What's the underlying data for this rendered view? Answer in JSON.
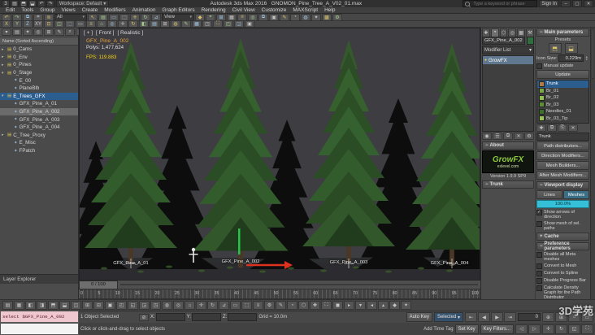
{
  "titlebar": {
    "qat": [
      {
        "n": "app-logo-icon",
        "g": "3"
      },
      {
        "n": "new-file-icon",
        "g": "▤"
      },
      {
        "n": "open-file-icon",
        "g": "⬒"
      },
      {
        "n": "save-file-icon",
        "g": "⬓"
      },
      {
        "n": "undo-icon",
        "g": "↶"
      },
      {
        "n": "redo-icon",
        "g": "↷"
      }
    ],
    "workspace": "Workspace: Default",
    "app_title": "Autodesk 3ds Max 2016",
    "doc_title": "GNOMON_Pine_Tree_A_V02_01.max",
    "search_placeholder": "Type a keyword or phrase",
    "sign_in": "Sign In",
    "minimize": "–",
    "maximize": "▢",
    "close": "✕"
  },
  "menubar": {
    "items": [
      "Edit",
      "Tools",
      "Group",
      "Views",
      "Create",
      "Modifiers",
      "Animation",
      "Graph Editors",
      "Rendering",
      "Civil View",
      "Customize",
      "MAXScript",
      "Help"
    ]
  },
  "toolbar_main": {
    "icons_a": [
      "↶",
      "↷",
      "⧉",
      "⌗",
      "≋"
    ],
    "filter_value": "All",
    "icons_b": [
      "↖",
      "▤",
      "▭",
      "⬚",
      "✛",
      "↻",
      "⊿"
    ],
    "coord_value": "View",
    "icons_c": [
      "◆",
      "⌖",
      "⊞",
      "▦",
      "≡",
      "◎",
      "⧉",
      "▣",
      "✎",
      "◔",
      "◍",
      "✦",
      "▩",
      "⚙"
    ]
  },
  "toolbar_axis": {
    "icons_a": [
      "X",
      "Y",
      "Z",
      "XY"
    ],
    "icons_b": [
      "⊡",
      "◫",
      "⬚",
      "▭",
      "≡",
      "⌂",
      "◎",
      "✛",
      "↻",
      "◧",
      "▤",
      "⊞",
      "◍",
      "✎",
      "▦",
      "◳",
      "⛶",
      "◰",
      "◲",
      "▣"
    ]
  },
  "explorer": {
    "tool_icons": [
      "▾",
      "▤",
      "✦",
      "◎",
      "⊞",
      "✎",
      "⌕",
      "≡"
    ],
    "header": "Name (Sorted Ascending)",
    "rows": [
      {
        "label": "0_Cams",
        "exp": "▸",
        "icon": "▤",
        "iconstyle": "color:#d9c05a",
        "style": ""
      },
      {
        "label": "0_Env",
        "exp": "▸",
        "icon": "▤",
        "iconstyle": "color:#d9c05a",
        "style": ""
      },
      {
        "label": "0_Pines",
        "exp": "▸",
        "icon": "▤",
        "iconstyle": "color:#d9c05a",
        "style": ""
      },
      {
        "label": "0_Stage",
        "exp": "▾",
        "icon": "▤",
        "iconstyle": "color:#d9c05a",
        "style": ""
      },
      {
        "label": "E_00",
        "exp": "",
        "icon": "✦",
        "iconstyle": "color:#9fb6d8",
        "style": "padding-left:10px"
      },
      {
        "label": "PlaneBlb",
        "exp": "",
        "icon": "✦",
        "iconstyle": "color:#9fb6d8",
        "style": "padding-left:10px"
      },
      {
        "label": "E_Trees_GFX",
        "exp": "▾",
        "icon": "▤",
        "iconstyle": "color:#d9c05a",
        "style": "",
        "selected": true
      },
      {
        "label": "GFX_Pine_A_01",
        "exp": "",
        "icon": "✦",
        "iconstyle": "color:#9fb6d8",
        "style": "padding-left:10px"
      },
      {
        "label": "GFX_Pine_A_002",
        "exp": "",
        "icon": "✦",
        "iconstyle": "color:#9fb6d8",
        "style": "padding-left:10px",
        "current": true
      },
      {
        "label": "GFX_Pine_A_003",
        "exp": "",
        "icon": "✦",
        "iconstyle": "color:#9fb6d8",
        "style": "padding-left:10px"
      },
      {
        "label": "GFX_Pine_A_004",
        "exp": "",
        "icon": "✦",
        "iconstyle": "color:#9fb6d8",
        "style": "padding-left:10px"
      },
      {
        "label": "C_Tree_Proxy",
        "exp": "▸",
        "icon": "▤",
        "iconstyle": "color:#d9c05a",
        "style": ""
      },
      {
        "label": "E_Misc",
        "exp": "",
        "icon": "✦",
        "iconstyle": "color:#9fb6d8",
        "style": "padding-left:10px"
      },
      {
        "label": "FPatch",
        "exp": "",
        "icon": "✦",
        "iconstyle": "color:#9fb6d8",
        "style": "padding-left:10px"
      }
    ],
    "footer": "Layer Explorer"
  },
  "viewport": {
    "label_plus": "[ + ]",
    "label_view": "[ Front ]",
    "label_shading": "[ Realistic ]",
    "stats_name": "GFX_Pine_A_002",
    "stats_polys": "Polys: 1,477,624",
    "stats_fps": "FPS: 119.883",
    "tree_labels": [
      {
        "t": "GFX_Pine_A_01",
        "style": "left:63px;top:286px"
      },
      {
        "t": "GFX_Pine_A_002",
        "style": "left:198px;top:284px"
      },
      {
        "t": "GFX_Pine_A_003",
        "style": "left:331px;top:285px"
      },
      {
        "t": "GFX_Pine_A_004",
        "style": "left:455px;top:286px"
      }
    ]
  },
  "timeline": {
    "slider": "0 / 100",
    "ticks": [
      "0",
      "5",
      "10",
      "15",
      "20",
      "25",
      "30",
      "35",
      "40",
      "45",
      "50",
      "55",
      "60",
      "65",
      "70",
      "75",
      "80",
      "85",
      "90",
      "95",
      "100"
    ]
  },
  "cmdpanel": {
    "tabs": [
      {
        "n": "create-tab-icon",
        "g": "✚"
      },
      {
        "n": "modify-tab-icon",
        "g": "◔",
        "active": true
      },
      {
        "n": "hierarchy-tab-icon",
        "g": "⬡"
      },
      {
        "n": "motion-tab-icon",
        "g": "◎"
      },
      {
        "n": "display-tab-icon",
        "g": "▦"
      },
      {
        "n": "utilities-tab-icon",
        "g": "⚒"
      }
    ],
    "object_name": "GFX_Pine_A_002",
    "modifier_list": "Modifier List",
    "stack": [
      {
        "label": "GrowFX",
        "selected": true
      }
    ],
    "stack_buttons": [
      {
        "n": "pin-stack-icon",
        "g": "◉"
      },
      {
        "n": "show-end-result-icon",
        "g": "☰"
      },
      {
        "n": "make-unique-icon",
        "g": "⧉"
      },
      {
        "n": "remove-modifier-icon",
        "g": "✕"
      },
      {
        "n": "configure-modifier-sets-icon",
        "g": "⚙"
      }
    ],
    "about_header": "About",
    "logo_text": "GrowFX",
    "logo_sub": "exlevel.com",
    "version": "Version 1.9.9 SP9",
    "trunk_rollout": "Trunk"
  },
  "gfx": {
    "header": "Main parameters",
    "presets_label": "Presets",
    "preset_icons": [
      {
        "n": "open-preset-icon",
        "g": "⬒"
      },
      {
        "n": "save-preset-icon",
        "g": "⬓"
      }
    ],
    "icon_size_label": "Icon Size:",
    "icon_size": "0.229m",
    "manual_update": "Manual update",
    "update": "Update",
    "paths": [
      {
        "name": "Trunk",
        "chipstyle": "background:#ad7d45",
        "selected": true
      },
      {
        "name": "Br_01",
        "chipstyle": "background:#7aa843"
      },
      {
        "name": "Br_02",
        "chipstyle": "background:#8fbf4e"
      },
      {
        "name": "Br_03",
        "chipstyle": "background:#5d8f35"
      },
      {
        "name": "Needles_01",
        "chipstyle": "background:#3f7029"
      },
      {
        "name": "Br_03_Tip",
        "chipstyle": "background:#9ac45a"
      }
    ],
    "path_tools": [
      {
        "n": "add-path-icon",
        "g": "✚"
      },
      {
        "n": "copy-path-icon",
        "g": "⧉"
      },
      {
        "n": "paste-path-icon",
        "g": "⎘"
      },
      {
        "n": "delete-path-icon",
        "g": "✕"
      }
    ],
    "path_name": "Trunk",
    "buttons": [
      "Path distributors...",
      "Direction Modifiers...",
      "Mesh Builders...",
      "After Mesh Modifiers..."
    ],
    "vd_header": "Viewport display",
    "lines_btn": "Lines",
    "meshes_btn": "Meshes",
    "percent": "100.0%",
    "vd_checks": [
      {
        "label": "Show arrows of direction",
        "checked": true
      },
      {
        "label": "Show mesh of sel. paths",
        "checked": false
      }
    ],
    "cache_header": "Cache",
    "pref_header": "Preference parameters",
    "pref_checks": [
      {
        "label": "Disable all Meta meshes",
        "checked": false
      },
      {
        "label": "Convert to Mesh",
        "checked": false
      },
      {
        "label": "Convert to Spline",
        "checked": false
      },
      {
        "label": "Disable Progress Bar",
        "checked": false
      },
      {
        "label": "Calculate Density Graph for the Path Distributor",
        "checked": false
      }
    ]
  },
  "dock": {
    "icons": [
      "▤",
      "▦",
      "◧",
      "◨",
      "⬒",
      "⬓",
      "◫",
      "⊞",
      "⊟",
      "▣",
      "◰",
      "◱",
      "◲",
      "◳",
      "◍",
      "◎",
      "⌂",
      "✛",
      "↻",
      "⊿",
      "▭",
      "⬚",
      "≡",
      "⚙",
      "✎",
      "◔",
      "⬡",
      "✚",
      "⛶",
      "◼",
      "▸",
      "▾",
      "◂",
      "▴",
      "◆",
      "✦"
    ]
  },
  "status": {
    "listener_line1": "select $GFX_Pine_A_002",
    "listener_line2": "",
    "selected_info": "1 Object Selected",
    "x_label": "X:",
    "y_label": "Y:",
    "z_label": "Z:",
    "grid": "Grid = 10.0m",
    "auto_key": "Auto Key",
    "set_key": "Set Key",
    "selected_combo": "Selected",
    "key_filters": "Key Filters...",
    "time_value": "0",
    "prompt": "Click or click-and-drag to select objects",
    "add_time_tag": "Add Time Tag",
    "transport_b": [
      "⇤",
      "◀",
      "▶",
      "⇥"
    ],
    "transport_c": [
      "◁",
      "▷"
    ],
    "nav_b": [
      {
        "n": "zoom-icon",
        "g": "⊕"
      },
      {
        "n": "zoom-all-icon",
        "g": "⊞"
      },
      {
        "n": "zoom-extents-icon",
        "g": "⌂"
      },
      {
        "n": "zoom-region-icon",
        "g": "▭"
      }
    ],
    "nav_c": [
      {
        "n": "pan-icon",
        "g": "✛"
      },
      {
        "n": "orbit-icon",
        "g": "↻"
      },
      {
        "n": "field-of-view-icon",
        "g": "◱"
      },
      {
        "n": "maximize-viewport-icon",
        "g": "⛶"
      }
    ]
  },
  "watermark": "3D学苑"
}
